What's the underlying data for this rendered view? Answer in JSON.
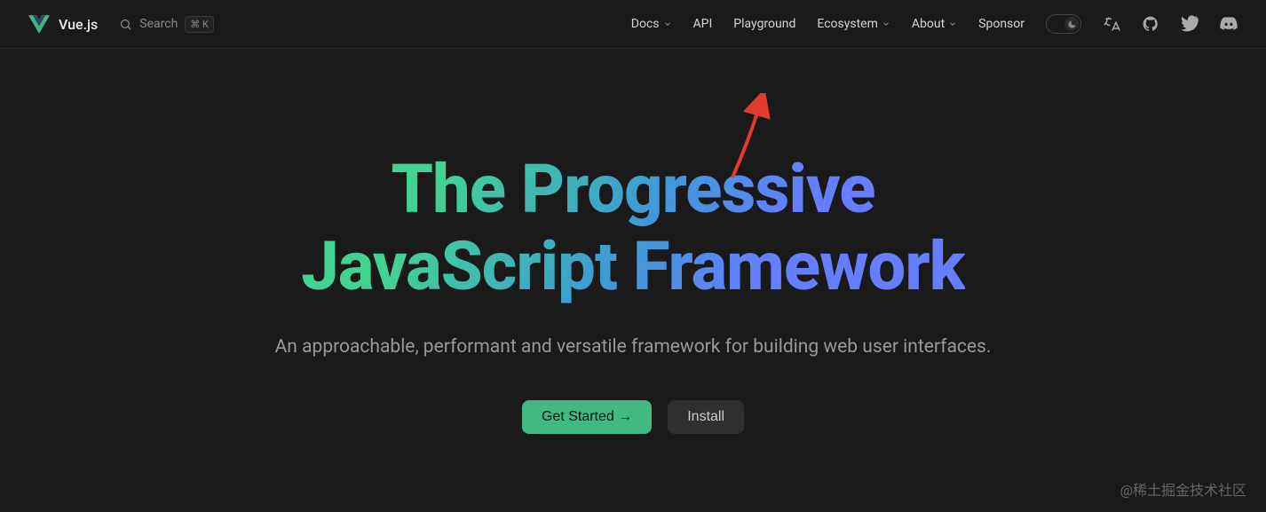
{
  "brand": {
    "name": "Vue.js"
  },
  "search": {
    "placeholder": "Search",
    "shortcut": "⌘ K"
  },
  "nav": {
    "docs": "Docs",
    "api": "API",
    "playground": "Playground",
    "ecosystem": "Ecosystem",
    "about": "About",
    "sponsor": "Sponsor"
  },
  "hero": {
    "title_line1": "The Progressive",
    "title_line2": "JavaScript Framework",
    "subtitle": "An approachable, performant and versatile framework for building web user interfaces.",
    "cta_primary": "Get Started →",
    "cta_secondary": "Install"
  },
  "watermark": "@稀土掘金技术社区"
}
